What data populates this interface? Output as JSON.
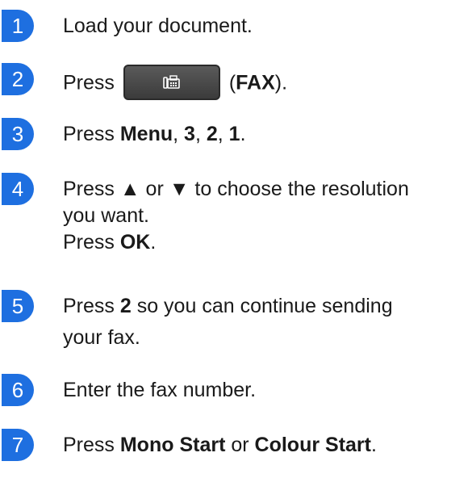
{
  "steps": [
    {
      "number": "1",
      "text": "Load your document."
    },
    {
      "number": "2",
      "prefix": "Press",
      "open_paren": "(",
      "bold": "FAX",
      "suffix": ")."
    },
    {
      "number": "3",
      "prefix": "Press ",
      "b1": "Menu",
      "s1": ", ",
      "b2": "3",
      "s2": ", ",
      "b3": "2",
      "s3": ", ",
      "b4": "1",
      "s4": "."
    },
    {
      "number": "4",
      "line1": "Press ▲ or ▼ to choose the resolution",
      "line2": "you want.",
      "line3_prefix": "Press ",
      "line3_bold": "OK",
      "line3_suffix": "."
    },
    {
      "number": "5",
      "prefix": "Press ",
      "bold": "2",
      "suffix": " so you can continue sending",
      "line2": "your fax."
    },
    {
      "number": "6",
      "text": "Enter the fax number."
    },
    {
      "number": "7",
      "prefix": "Press ",
      "b1": "Mono Start",
      "s1": " or ",
      "b2": "Colour Start",
      "s2": "."
    }
  ],
  "colors": {
    "badge": "#1e6fe0",
    "button": "#4a4a4a"
  },
  "icons": {
    "fax_button_icon": "fax-icon"
  }
}
